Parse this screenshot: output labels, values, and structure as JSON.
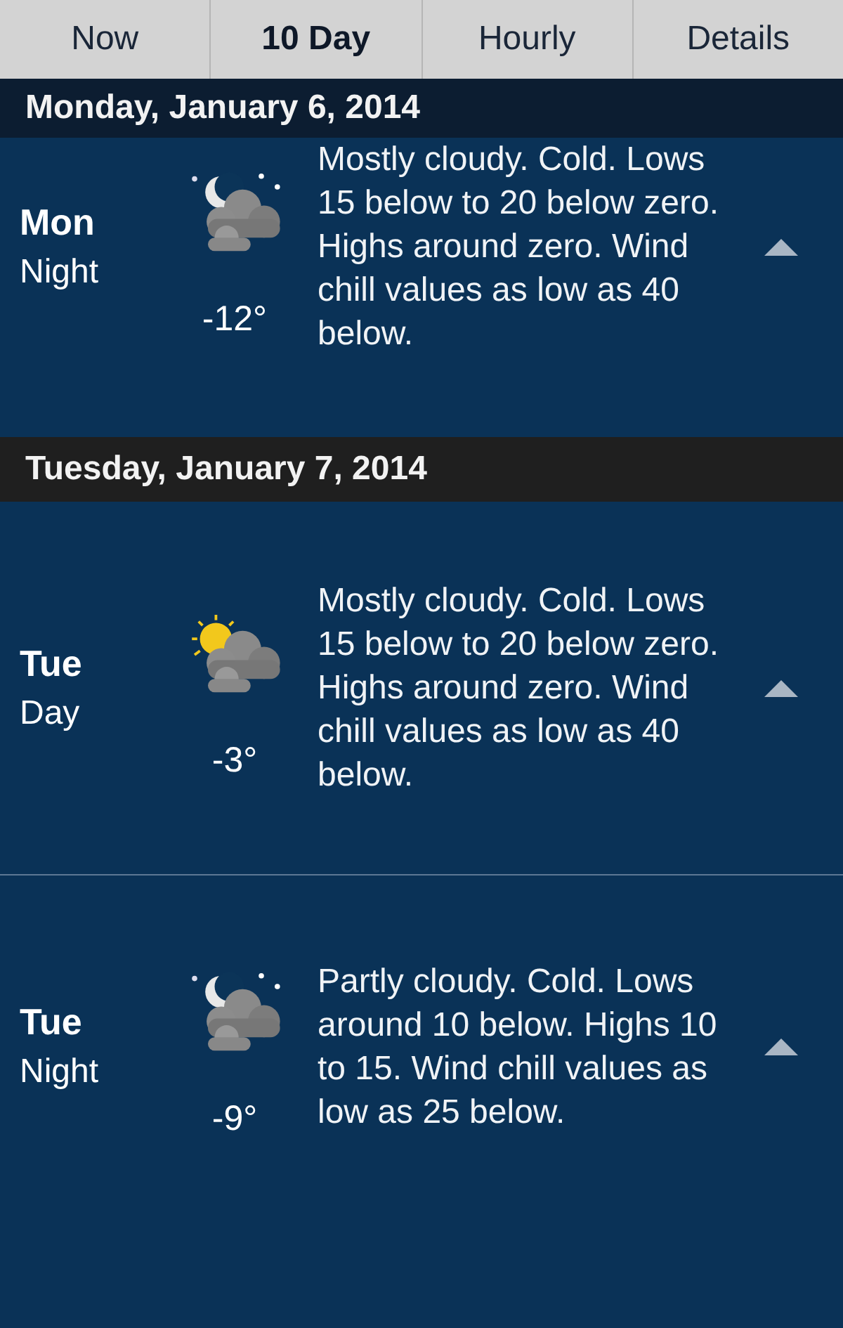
{
  "tabs": [
    {
      "label": "Now",
      "selected": false
    },
    {
      "label": "10 Day",
      "selected": true
    },
    {
      "label": "Hourly",
      "selected": false
    },
    {
      "label": "Details",
      "selected": false
    }
  ],
  "sections": [
    {
      "date": "Monday, January 6, 2014",
      "periods": [
        {
          "kind": "night",
          "day": "Mon",
          "part": "Night",
          "temp": "-12°",
          "text": "Mostly cloudy. Cold. Lows 15 below to 20 below zero. Highs around zero. Wind chill values as low as 40 below."
        }
      ]
    },
    {
      "date": "Tuesday, January 7, 2014",
      "periods": [
        {
          "kind": "day",
          "day": "Tue",
          "part": "Day",
          "temp": "-3°",
          "text": "Mostly cloudy. Cold. Lows 15 below to 20 below zero. Highs around zero. Wind chill values as low as 40 below."
        },
        {
          "kind": "night",
          "day": "Tue",
          "part": "Night",
          "temp": "-9°",
          "text": "Partly cloudy. Cold. Lows around 10 below. Highs 10 to 15. Wind chill values as low as 25 below."
        }
      ]
    }
  ]
}
